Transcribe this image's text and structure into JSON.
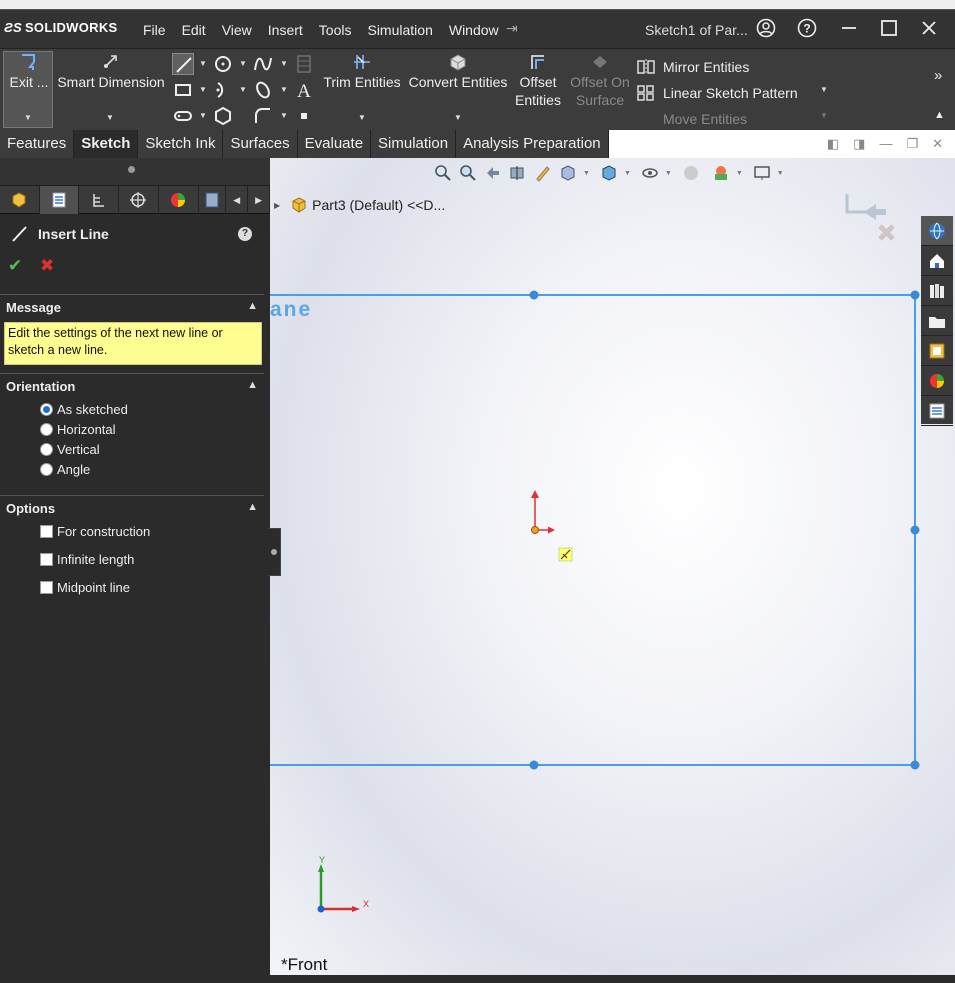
{
  "app": {
    "logo_text": "SOLIDWORKS",
    "document_title": "Sketch1 of Par..."
  },
  "menu": [
    "File",
    "Edit",
    "View",
    "Insert",
    "Tools",
    "Simulation",
    "Window"
  ],
  "command_manager": {
    "exit_label": "Exit ...",
    "smart_dimension_label": "Smart Dimension",
    "trim_label": "Trim Entities",
    "convert_label": "Convert Entities",
    "offset_label_1": "Offset",
    "offset_label_2": "Entities",
    "offset_surface_label_1": "Offset On",
    "offset_surface_label_2": "Surface",
    "mirror_label": "Mirror Entities",
    "linear_pattern_label": "Linear Sketch Pattern",
    "move_label": "Move Entities"
  },
  "tabs": [
    {
      "label": "Features",
      "active": false
    },
    {
      "label": "Sketch",
      "active": true
    },
    {
      "label": "Sketch Ink",
      "active": false
    },
    {
      "label": "Surfaces",
      "active": false
    },
    {
      "label": "Evaluate",
      "active": false
    },
    {
      "label": "Simulation",
      "active": false
    },
    {
      "label": "Analysis Preparation",
      "active": false
    }
  ],
  "property_manager": {
    "title": "Insert Line",
    "message_header": "Message",
    "message_text": "Edit the settings of the next new line or sketch a new line.",
    "orientation_header": "Orientation",
    "orientation_options": [
      {
        "label": "As sketched",
        "selected": true
      },
      {
        "label": "Horizontal",
        "selected": false
      },
      {
        "label": "Vertical",
        "selected": false
      },
      {
        "label": "Angle",
        "selected": false
      }
    ],
    "options_header": "Options",
    "options": [
      {
        "label": "For construction",
        "checked": false
      },
      {
        "label": "Infinite length",
        "checked": false
      },
      {
        "label": "Midpoint line",
        "checked": false
      }
    ]
  },
  "graphics": {
    "tree_root": "Part3 (Default) <<D...",
    "plane_label": "ane",
    "view_label": "*Front",
    "axis_x": "X",
    "axis_y": "Y",
    "sketch_color": "#4a9de6",
    "origin_color": "#e03030"
  }
}
